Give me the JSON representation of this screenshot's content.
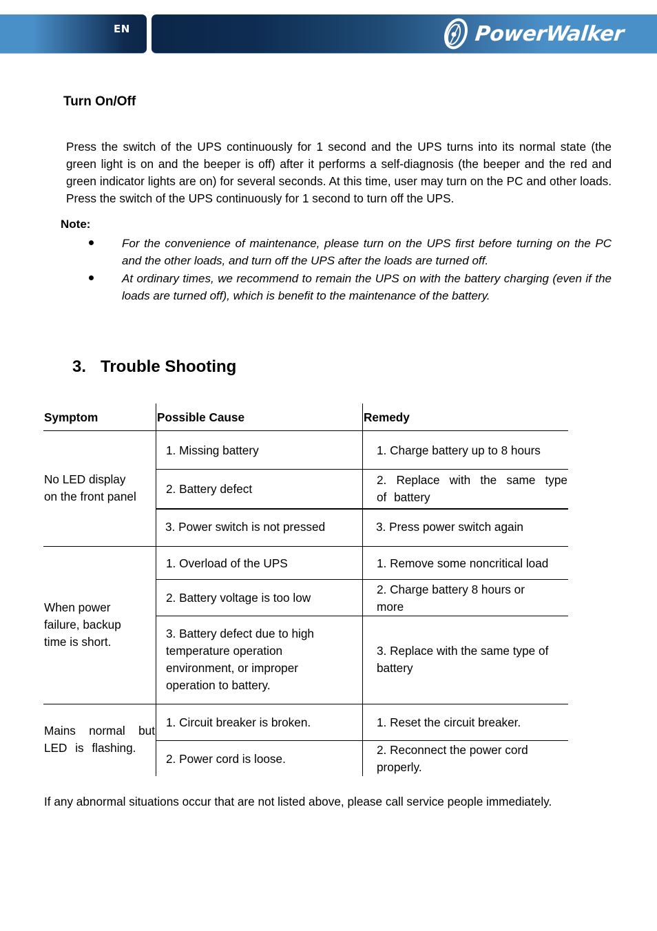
{
  "header": {
    "language": "EN",
    "brand": "PowerWalker",
    "colors": {
      "light_blue": "#4a90c8",
      "dark_navy": "#0b2648"
    }
  },
  "turn_on_off": {
    "title": "Turn On/Off",
    "paragraph": "Press the switch of the UPS continuously for 1 second and the UPS turns into its normal state (the green light is on and the beeper is off) after it performs a self-diagnosis (the beeper and the red and green indicator lights are on) for several seconds. At this time, user may turn on the PC and other loads. Press the switch of the UPS continuously for 1 second to turn off the UPS.",
    "note_label": "Note:",
    "notes": [
      "For the convenience of maintenance, please turn on the UPS first before turning on the PC and the other loads, and turn off the UPS after the loads are turned off.",
      "At ordinary times, we recommend to remain the UPS on with the battery charging (even if the loads are turned off), which is benefit to the maintenance of the battery."
    ]
  },
  "troubleshooting": {
    "number": "3.",
    "title": "Trouble Shooting",
    "columns": [
      "Symptom",
      "Possible Cause",
      "Remedy"
    ],
    "groups": [
      {
        "symptom": "No LED display on the front panel",
        "symptom_lines": [
          "No LED display",
          "on the front panel"
        ],
        "rows": [
          {
            "cause": "1. Missing battery",
            "remedy": "1. Charge battery up to 8 hours"
          },
          {
            "cause": "2. Battery defect",
            "remedy": "2. Replace with the same type of battery"
          },
          {
            "cause": "3. Power switch is not pressed",
            "remedy": "3. Press power switch again"
          }
        ]
      },
      {
        "symptom": "When power failure, backup time is short.",
        "symptom_lines": [
          "When power",
          "failure, backup",
          "time is short."
        ],
        "rows": [
          {
            "cause": "1. Overload of the UPS",
            "remedy": "1. Remove some noncritical load"
          },
          {
            "cause": "2. Battery voltage is too low",
            "remedy": "2. Charge battery 8 hours or more"
          },
          {
            "cause": "3. Battery defect due to high temperature operation environment, or improper operation to battery.",
            "remedy": "3. Replace with the same type of battery"
          }
        ]
      },
      {
        "symptom": "Mains normal but LED is flashing.",
        "rows": [
          {
            "cause": "1. Circuit breaker is broken.",
            "remedy": "1. Reset the circuit breaker."
          },
          {
            "cause": "2. Power cord is loose.",
            "remedy": "2. Reconnect the power cord properly."
          }
        ]
      }
    ],
    "footer": "If any abnormal situations occur that are not listed above, please call service people immediately."
  }
}
